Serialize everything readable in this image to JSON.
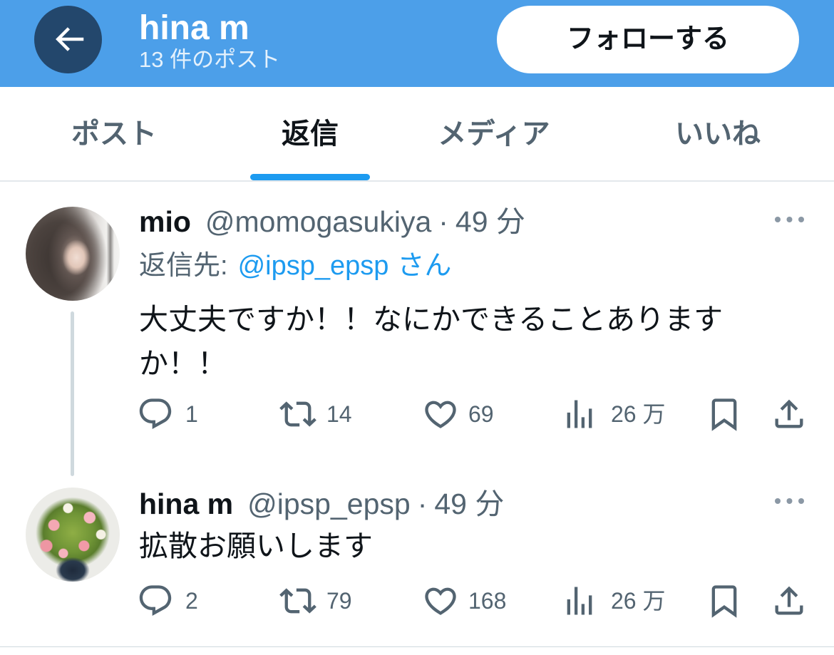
{
  "header": {
    "name": "hina m",
    "post_count": "13 件のポスト",
    "follow_label": "フォローする"
  },
  "tabs": [
    {
      "label": "ポスト",
      "active": false
    },
    {
      "label": "返信",
      "active": true
    },
    {
      "label": "メディア",
      "active": false
    },
    {
      "label": "いいね",
      "active": false
    }
  ],
  "posts": [
    {
      "display_name": "mio",
      "handle": "@momogasukiya",
      "separator": "·",
      "time": "49 分",
      "reply_to": {
        "label": "返信先:",
        "handle": "@ipsp_epsp",
        "suffix": "さん"
      },
      "text": "大丈夫ですか！！なにかできることありますか！！",
      "stats": {
        "replies": "1",
        "reposts": "14",
        "likes": "69",
        "views": "26 万"
      }
    },
    {
      "display_name": "hina m",
      "handle": "@ipsp_epsp",
      "separator": "·",
      "time": "49 分",
      "text": "拡散お願いします",
      "stats": {
        "replies": "2",
        "reposts": "79",
        "likes": "168",
        "views": "26 万"
      }
    }
  ],
  "icons": {
    "back": "arrow-left-icon",
    "more": "more-icon",
    "reply": "reply-icon",
    "repost": "repost-icon",
    "like": "heart-icon",
    "views": "views-icon",
    "bookmark": "bookmark-icon",
    "share": "share-icon"
  },
  "colors": {
    "header_background": "#4C9FE9",
    "back_button": "#23476C",
    "accent": "#1D9BF0",
    "text_primary": "#0F1419",
    "text_secondary": "#536471",
    "thread_line": "#CFD9DE"
  }
}
